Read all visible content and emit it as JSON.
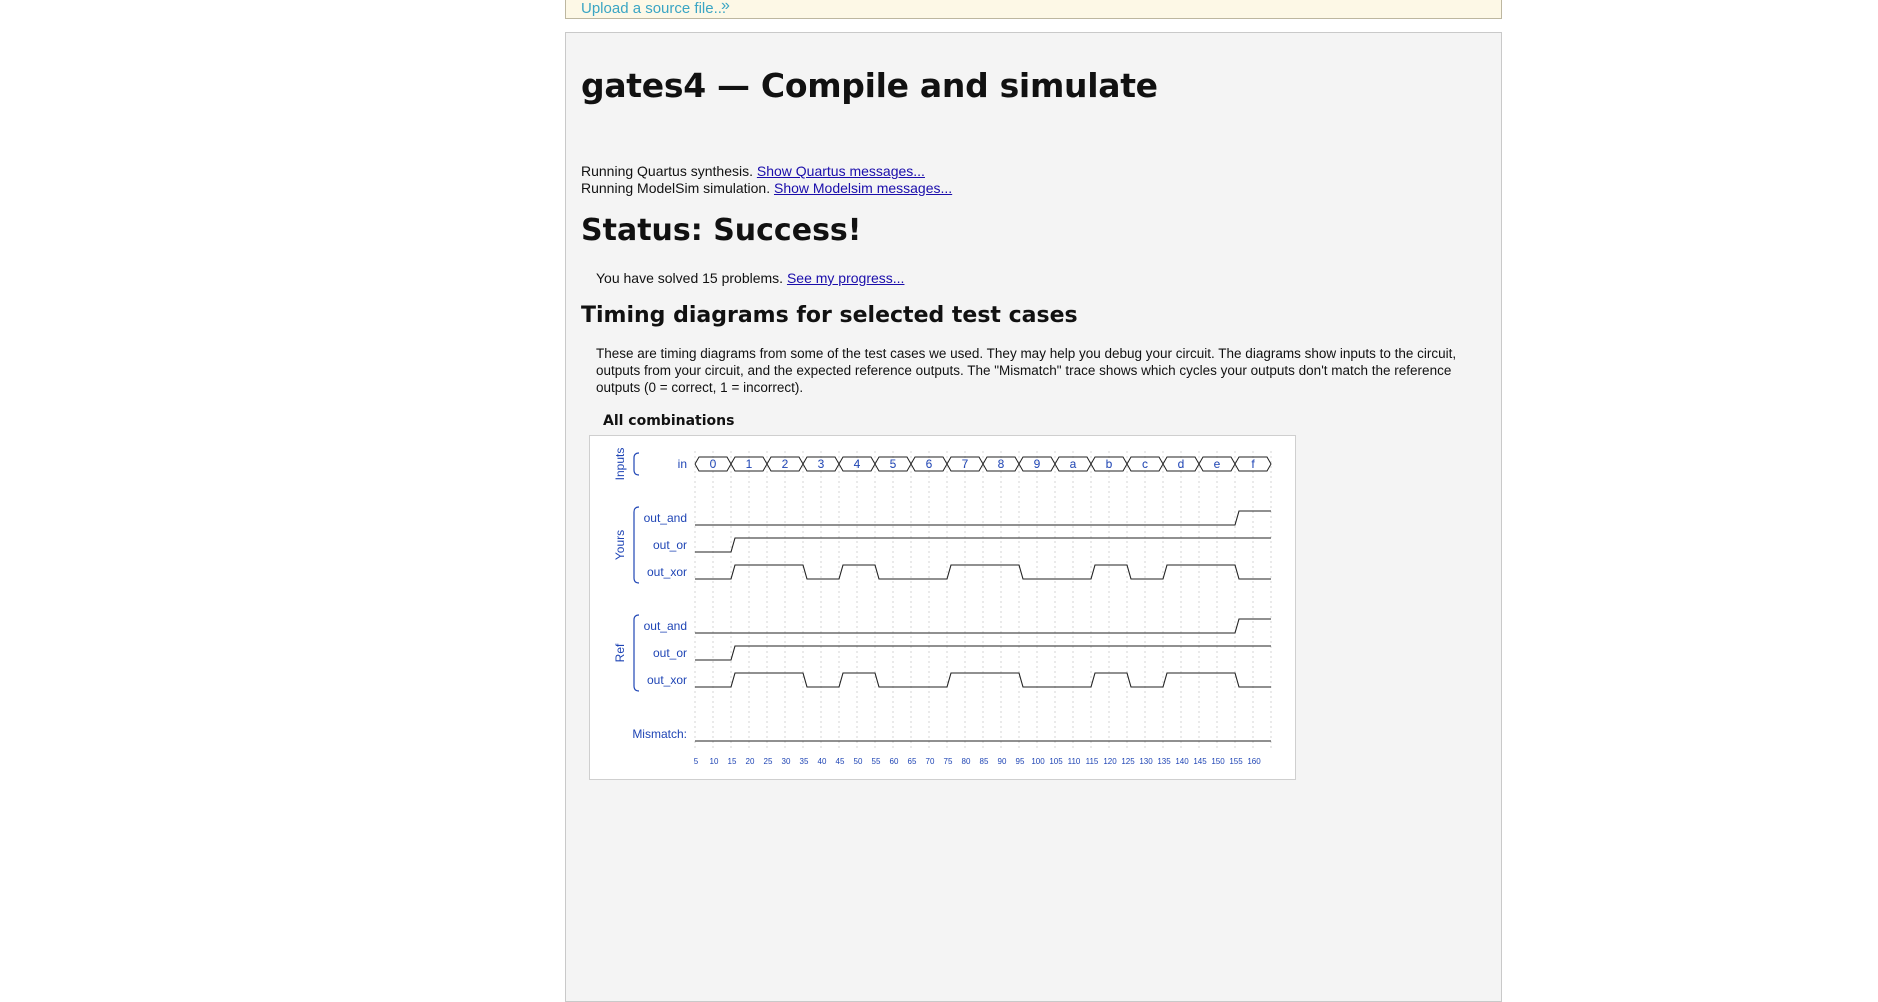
{
  "upload": {
    "label": "Upload a source file...",
    "icon": "double-chevron-down-icon"
  },
  "page": {
    "title": "gates4 — Compile and simulate",
    "synthesis_text": "Running Quartus synthesis.",
    "synthesis_link": "Show Quartus messages...",
    "simulation_text": "Running ModelSim simulation.",
    "simulation_link": "Show Modelsim messages...",
    "status": "Status: Success!",
    "solved_text": "You have solved 15 problems.",
    "progress_link": "See my progress...",
    "timing_heading": "Timing diagrams for selected test cases",
    "timing_desc": "These are timing diagrams from some of the test cases we used. They may help you debug your circuit. The diagrams show inputs to the circuit, outputs from your circuit, and the expected reference outputs. The \"Mismatch\" trace shows which cycles your outputs don't match the reference outputs (0 = correct, 1 = incorrect).",
    "diagram_caption": "All combinations"
  },
  "chart_data": {
    "type": "timing",
    "groups": [
      {
        "name": "Inputs",
        "signals": [
          "in"
        ]
      },
      {
        "name": "Yours",
        "signals": [
          "out_and",
          "out_or",
          "out_xor"
        ]
      },
      {
        "name": "Ref",
        "signals": [
          "out_and",
          "out_or",
          "out_xor"
        ]
      }
    ],
    "bus_values": [
      "0",
      "1",
      "2",
      "3",
      "4",
      "5",
      "6",
      "7",
      "8",
      "9",
      "a",
      "b",
      "c",
      "d",
      "e",
      "f"
    ],
    "traces": {
      "yours_out_and": [
        0,
        0,
        0,
        0,
        0,
        0,
        0,
        0,
        0,
        0,
        0,
        0,
        0,
        0,
        0,
        1
      ],
      "yours_out_or": [
        0,
        1,
        1,
        1,
        1,
        1,
        1,
        1,
        1,
        1,
        1,
        1,
        1,
        1,
        1,
        1
      ],
      "yours_out_xor": [
        0,
        1,
        1,
        0,
        1,
        0,
        0,
        1,
        1,
        0,
        0,
        1,
        0,
        1,
        1,
        0
      ],
      "ref_out_and": [
        0,
        0,
        0,
        0,
        0,
        0,
        0,
        0,
        0,
        0,
        0,
        0,
        0,
        0,
        0,
        1
      ],
      "ref_out_or": [
        0,
        1,
        1,
        1,
        1,
        1,
        1,
        1,
        1,
        1,
        1,
        1,
        1,
        1,
        1,
        1
      ],
      "ref_out_xor": [
        0,
        1,
        1,
        0,
        1,
        0,
        0,
        1,
        1,
        0,
        0,
        1,
        0,
        1,
        1,
        0
      ],
      "mismatch": [
        0,
        0,
        0,
        0,
        0,
        0,
        0,
        0,
        0,
        0,
        0,
        0,
        0,
        0,
        0,
        0
      ]
    },
    "mismatch_label": "Mismatch:",
    "time_ticks": [
      "5",
      "10",
      "15",
      "20",
      "25",
      "30",
      "35",
      "40",
      "45",
      "50",
      "55",
      "60",
      "65",
      "70",
      "75",
      "80",
      "85",
      "90",
      "95",
      "100",
      "105",
      "110",
      "115",
      "120",
      "125",
      "130",
      "135",
      "140",
      "145",
      "150",
      "155",
      "160"
    ]
  }
}
